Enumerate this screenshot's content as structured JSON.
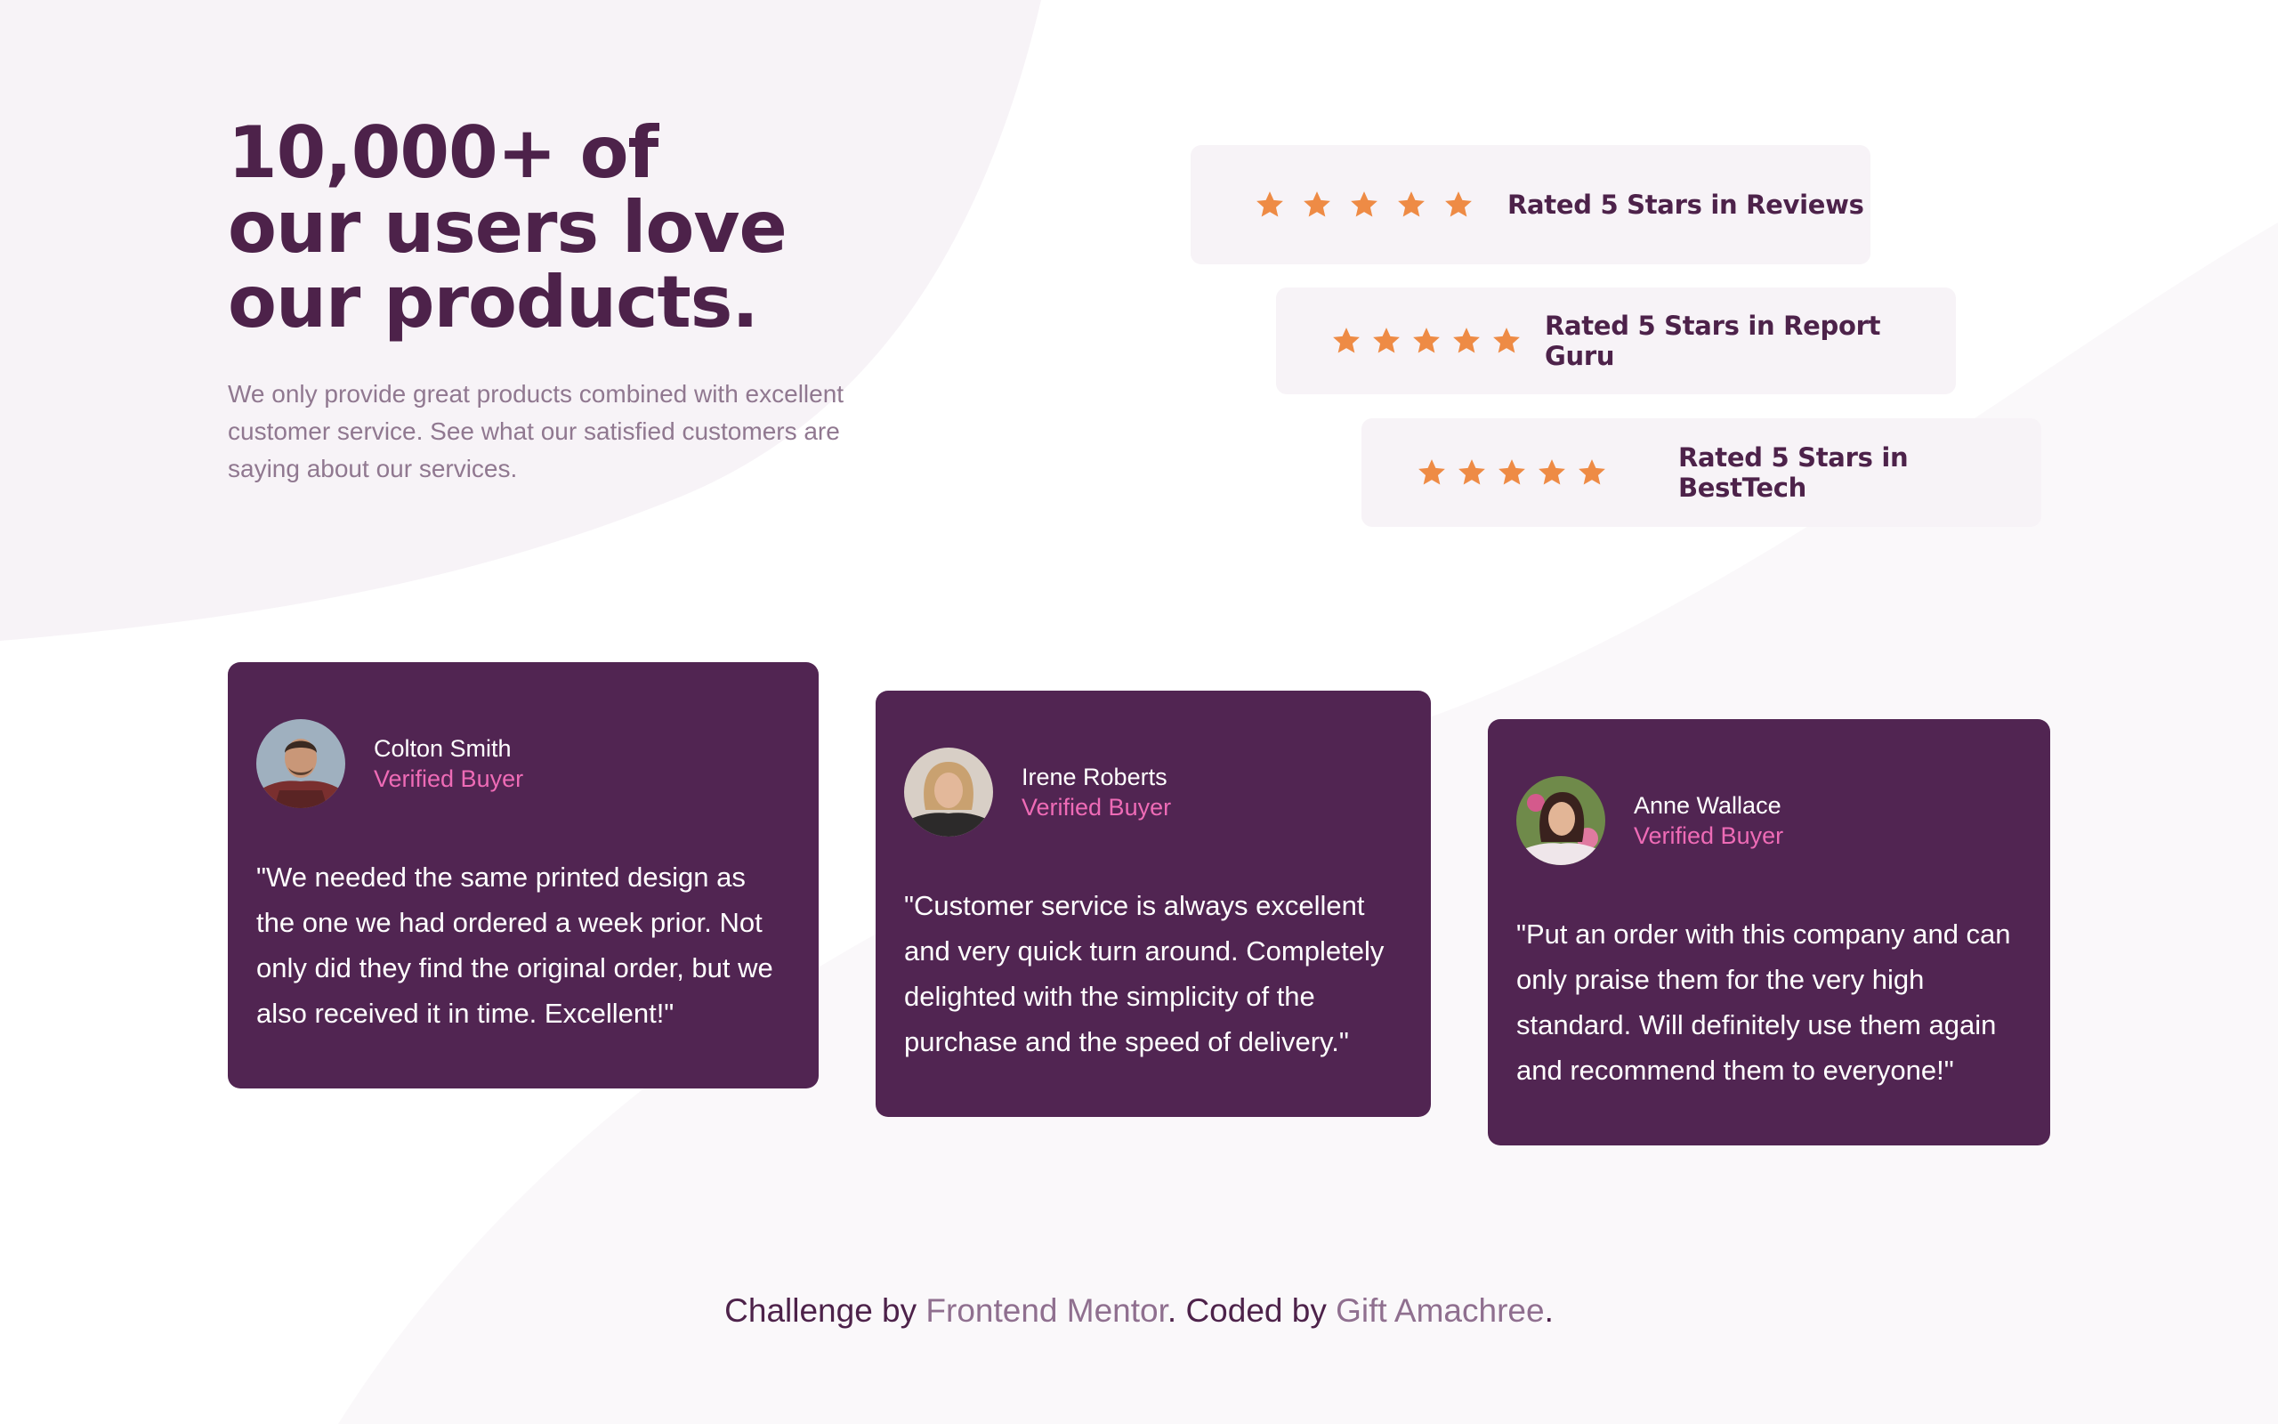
{
  "hero": {
    "headline": [
      "10,000+ of",
      "our users love",
      "our products."
    ],
    "subtext": "We only provide great products combined with excellent customer service. See what our satisfied customers are saying about our services."
  },
  "ratings": [
    {
      "label": "Rated 5 Stars in Reviews",
      "stars": 5
    },
    {
      "label": "Rated 5 Stars in Report Guru",
      "stars": 5
    },
    {
      "label": "Rated 5 Stars in BestTech",
      "stars": 5
    }
  ],
  "testimonials": [
    {
      "name": "Colton Smith",
      "role": "Verified Buyer",
      "quote": "\"We needed the same printed design as the one we had ordered a week prior. Not only did they find the original order, but we also received it in time. Excellent!\""
    },
    {
      "name": "Irene Roberts",
      "role": "Verified Buyer",
      "quote": "\"Customer service is always excellent and very quick turn around. Completely delighted with the simplicity of the purchase and the speed of delivery.\""
    },
    {
      "name": "Anne Wallace",
      "role": "Verified Buyer",
      "quote": "\"Put an order with this company and can only praise them for the very high standard. Will definitely use them again and recommend them to everyone!\""
    }
  ],
  "footer": {
    "prefix": "Challenge by ",
    "mentor_link": "Frontend Mentor",
    "middle": ". Coded by ",
    "author_link": "Gift Amachree",
    "suffix": "."
  },
  "colors": {
    "dark_magenta": "#4d224a",
    "card_bg": "#512552",
    "star_orange": "#ee8b45",
    "verified_pink": "#ee6bb6",
    "light_panel": "#f7f3f7",
    "muted_text": "#907890"
  }
}
